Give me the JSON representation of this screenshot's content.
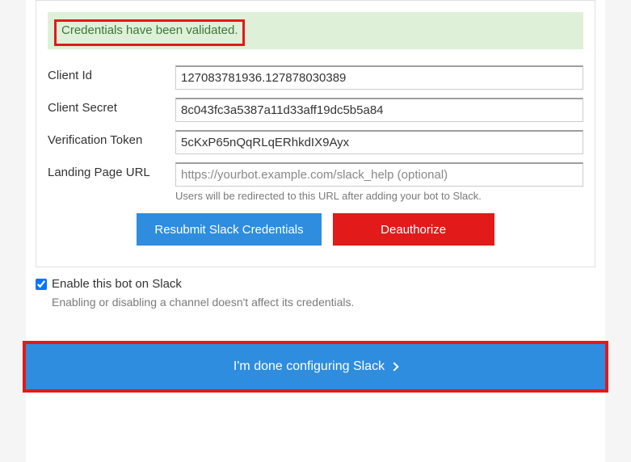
{
  "alert": {
    "message": "Credentials have been validated."
  },
  "fields": {
    "client_id": {
      "label": "Client Id",
      "value": "127083781936.127878030389"
    },
    "client_secret": {
      "label": "Client Secret",
      "value": "8c043fc3a5387a11d33aff19dc5b5a84"
    },
    "verification_token": {
      "label": "Verification Token",
      "value": "5cKxP65nQqRLqERhkdIX9Ayx"
    },
    "landing_url": {
      "label": "Landing Page URL",
      "placeholder": "https://yourbot.example.com/slack_help (optional)",
      "help": "Users will be redirected to this URL after adding your bot to Slack."
    }
  },
  "buttons": {
    "resubmit": "Resubmit Slack Credentials",
    "deauthorize": "Deauthorize"
  },
  "enable": {
    "label": "Enable this bot on Slack",
    "help": "Enabling or disabling a channel doesn't affect its credentials."
  },
  "done": {
    "label": "I'm done configuring Slack"
  }
}
